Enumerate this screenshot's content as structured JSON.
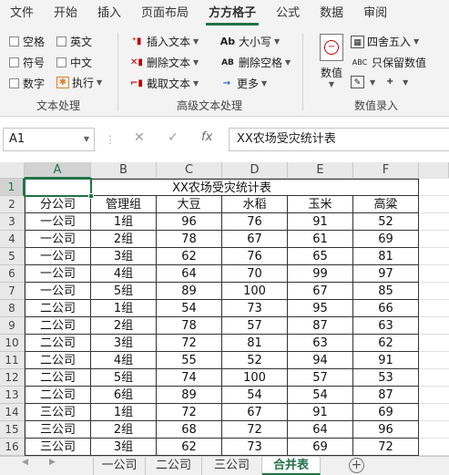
{
  "menubar": {
    "items": [
      "文件",
      "开始",
      "插入",
      "页面布局",
      "方方格子",
      "公式",
      "数据",
      "审阅"
    ],
    "active_index": 4,
    "accent": "#217346"
  },
  "ribbon": {
    "text_group": {
      "label": "文本处理",
      "checkboxes": [
        "空格",
        "英文",
        "符号",
        "中文",
        "数字"
      ],
      "execute_label": "执行"
    },
    "advanced_group": {
      "label": "高级文本处理",
      "insert_text": "插入文本",
      "delete_text": "删除文本",
      "extract_text": "截取文本",
      "case_label": "大小写",
      "case_icon": "Ab",
      "delete_spaces": "删除空格",
      "delete_spaces_icon": "AB",
      "more": "更多"
    },
    "number_group": {
      "label": "数值录入",
      "value_label": "数值",
      "round_label": "四舍五入",
      "keep_value": "只保留数值",
      "keep_value_icon": "ABC"
    }
  },
  "formula_bar": {
    "name_box": "A1",
    "fx": "fx",
    "content": "XX农场受灾统计表"
  },
  "sheet": {
    "columns": [
      "A",
      "B",
      "C",
      "D",
      "E",
      "F"
    ],
    "row_numbers": [
      "1",
      "2",
      "3",
      "4",
      "5",
      "6",
      "7",
      "8",
      "9",
      "10",
      "11",
      "12",
      "13",
      "14",
      "15",
      "16"
    ],
    "title": "XX农场受灾统计表",
    "headers": [
      "分公司",
      "管理组",
      "大豆",
      "水稻",
      "玉米",
      "高粱"
    ],
    "rows": [
      [
        "一公司",
        "1组",
        "96",
        "76",
        "91",
        "52"
      ],
      [
        "一公司",
        "2组",
        "78",
        "67",
        "61",
        "69"
      ],
      [
        "一公司",
        "3组",
        "62",
        "76",
        "65",
        "81"
      ],
      [
        "一公司",
        "4组",
        "64",
        "70",
        "99",
        "97"
      ],
      [
        "一公司",
        "5组",
        "89",
        "100",
        "67",
        "85"
      ],
      [
        "二公司",
        "1组",
        "54",
        "73",
        "95",
        "66"
      ],
      [
        "二公司",
        "2组",
        "78",
        "57",
        "87",
        "63"
      ],
      [
        "二公司",
        "3组",
        "72",
        "81",
        "63",
        "62"
      ],
      [
        "二公司",
        "4组",
        "55",
        "52",
        "94",
        "91"
      ],
      [
        "二公司",
        "5组",
        "74",
        "100",
        "57",
        "53"
      ],
      [
        "二公司",
        "6组",
        "89",
        "54",
        "54",
        "87"
      ],
      [
        "三公司",
        "1组",
        "72",
        "67",
        "91",
        "69"
      ],
      [
        "三公司",
        "2组",
        "68",
        "72",
        "64",
        "96"
      ],
      [
        "三公司",
        "3组",
        "62",
        "73",
        "69",
        "72"
      ]
    ]
  },
  "tabs": {
    "sheets": [
      "一公司",
      "二公司",
      "三公司",
      "合并表"
    ],
    "active_index": 3
  }
}
